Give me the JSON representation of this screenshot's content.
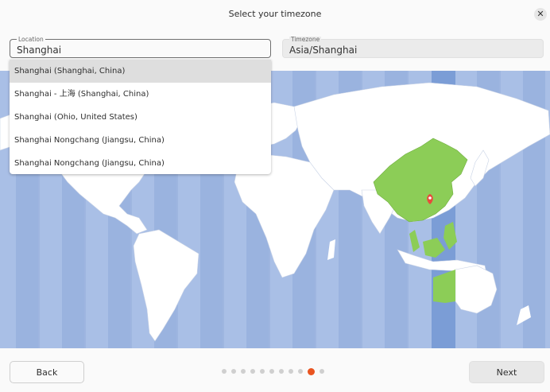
{
  "window": {
    "title": "Select your timezone",
    "close_icon": "close-icon"
  },
  "location": {
    "label": "Location",
    "value": "Shanghai"
  },
  "timezone": {
    "label": "Timezone",
    "value": "Asia/Shanghai"
  },
  "suggestions": [
    "Shanghai (Shanghai, China)",
    "Shanghai - 上海 (Shanghai, China)",
    "Shanghai (Ohio, United States)",
    "Shanghai Nongchang (Jiangsu, China)",
    "Shanghai Nongchang (Jiangsu, China)"
  ],
  "selected_suggestion_index": 0,
  "footer": {
    "back_label": "Back",
    "next_label": "Next",
    "step_count": 11,
    "current_step": 10
  },
  "colors": {
    "accent": "#e95420",
    "selected_zone": "#8ccd57",
    "ocean": "#a9bfe6",
    "zone_band": "#7b9dd6",
    "land": "#ffffff"
  },
  "map": {
    "marker_icon": "location-pin-icon",
    "selected_zone_name": "Asia/Shanghai"
  }
}
